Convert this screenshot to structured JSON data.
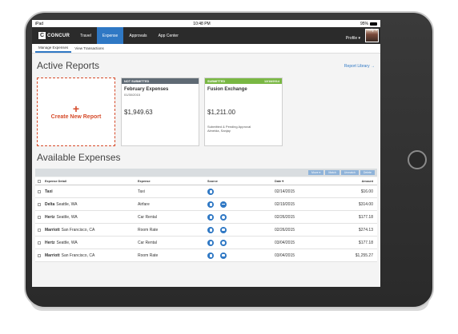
{
  "status_bar": {
    "device": "iPad",
    "time": "10:48 PM",
    "battery": "95%"
  },
  "nav": {
    "logo_letter": "C",
    "logo_text": "CONCUR",
    "items": [
      {
        "label": "Travel"
      },
      {
        "label": "Expense"
      },
      {
        "label": "Approvals"
      },
      {
        "label": "App Center"
      }
    ],
    "help": "Help ▾",
    "profile": "Profile ▾"
  },
  "subnav": {
    "items": [
      {
        "label": "Manage Expenses"
      },
      {
        "label": "View Transactions"
      }
    ]
  },
  "active_reports": {
    "title": "Active Reports",
    "library_link": "Report Library →",
    "create_label": "Create New Report",
    "create_plus": "+",
    "cards": [
      {
        "status": "NOT SUBMITTED",
        "status_date": "",
        "title": "February Expenses",
        "date": "01/30/2015",
        "amount": "$1,949.63",
        "line1": "",
        "line2": ""
      },
      {
        "status": "SUBMITTED",
        "status_date": "12/18/2014",
        "title": "Fusion Exchange",
        "date": "",
        "amount": "$1,211.00",
        "line1": "Submitted & Pending Approval",
        "line2": "Almeida, Sanjay"
      }
    ]
  },
  "available_expenses": {
    "title": "Available Expenses",
    "toolbar": [
      "Move ▾",
      "Match",
      "Unmatch",
      "Delete"
    ],
    "columns": {
      "detail": "Expense Detail",
      "expense": "Expense",
      "source": "Source",
      "date": "Date ▾",
      "amount": "Amount"
    },
    "rows": [
      {
        "vendor": "Taxi",
        "location": "",
        "expense": "Taxi",
        "sources": [
          "receipt"
        ],
        "date": "02/14/2015",
        "amount": "$16.00"
      },
      {
        "vendor": "Delta",
        "location": "Seattle, WA",
        "expense": "Airfare",
        "sources": [
          "receipt",
          "airfare"
        ],
        "date": "02/19/2015",
        "amount": "$314.00"
      },
      {
        "vendor": "Hertz",
        "location": "Seattle, WA",
        "expense": "Car Rental",
        "sources": [
          "receipt",
          "car"
        ],
        "date": "02/26/2015",
        "amount": "$177.18"
      },
      {
        "vendor": "Marriott",
        "location": "San Francisco, CA",
        "expense": "Room Rate",
        "sources": [
          "receipt",
          "hotel"
        ],
        "date": "02/26/2015",
        "amount": "$274.13"
      },
      {
        "vendor": "Hertz",
        "location": "Seattle, WA",
        "expense": "Car Rental",
        "sources": [
          "receipt",
          "car"
        ],
        "date": "03/04/2015",
        "amount": "$177.18"
      },
      {
        "vendor": "Marriott",
        "location": "San Francisco, CA",
        "expense": "Room Rate",
        "sources": [
          "receipt",
          "hotel"
        ],
        "date": "03/04/2015",
        "amount": "$1,255.27"
      }
    ]
  },
  "colors": {
    "accent": "#2f78c4",
    "create_red": "#d64b2a",
    "submitted_green": "#79b743",
    "not_submitted_gray": "#5f6a74",
    "nav_bg": "#2b2b2b"
  }
}
